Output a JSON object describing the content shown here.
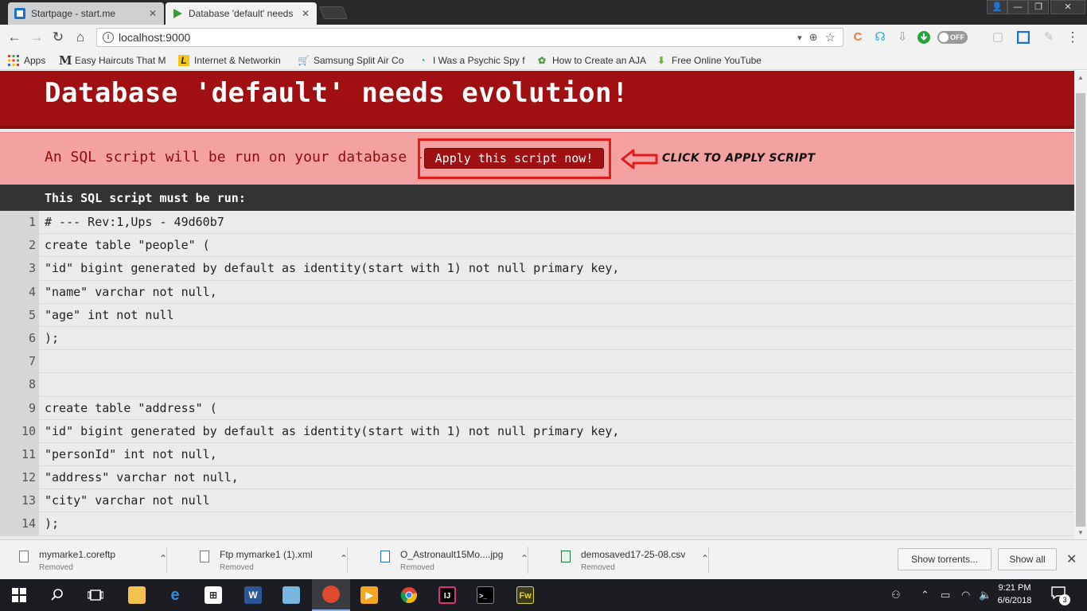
{
  "tabs": [
    {
      "title": "Startpage - start.me",
      "close": "✕"
    },
    {
      "title": "Database 'default' needs",
      "close": "✕"
    }
  ],
  "window_controls": {
    "user": "👤",
    "minimize": "—",
    "restore": "❐",
    "close": "✕"
  },
  "toolbar": {
    "back": "←",
    "forward": "→",
    "reload": "↻",
    "home": "⌂",
    "url": "localhost:9000",
    "info_icon": "i",
    "omnibox_icons": {
      "dropdown": "▾",
      "zoom": "⊕",
      "star": "☆"
    },
    "toggle_label": "OFF",
    "menu": "⋮"
  },
  "bookmarks": [
    {
      "label": "Apps",
      "icon": "apps-icon"
    },
    {
      "label": "Easy Haircuts That M",
      "icon": "m-icon"
    },
    {
      "label": "Internet & Networkin",
      "icon": "l-icon"
    },
    {
      "label": "Samsung Split Air Co",
      "icon": "cart-icon"
    },
    {
      "label": "I Was a Psychic Spy f",
      "icon": "swirl-icon"
    },
    {
      "label": "How to Create an AJA",
      "icon": "gear-icon"
    },
    {
      "label": "Free Online YouTube",
      "icon": "download-icon"
    }
  ],
  "page": {
    "heading": "Database 'default' needs evolution!",
    "message": "An SQL script will be run on your database -",
    "apply_button": "Apply this script now!",
    "callout": "CLICK TO APPLY SCRIPT",
    "script_label": "This SQL script must be run:",
    "lines": [
      {
        "n": "1",
        "text": "# --- Rev:1,Ups - 49d60b7"
      },
      {
        "n": "2",
        "text": "create table \"people\" ("
      },
      {
        "n": "3",
        "text": "\"id\" bigint generated by default as identity(start with 1) not null primary key,"
      },
      {
        "n": "4",
        "text": "\"name\" varchar not null,"
      },
      {
        "n": "5",
        "text": "\"age\" int not null"
      },
      {
        "n": "6",
        "text": ");"
      },
      {
        "n": "7",
        "text": ""
      },
      {
        "n": "8",
        "text": ""
      },
      {
        "n": "9",
        "text": "create table \"address\" ("
      },
      {
        "n": "10",
        "text": "\"id\" bigint generated by default as identity(start with 1) not null primary key,"
      },
      {
        "n": "11",
        "text": "\"personId\" int not null,"
      },
      {
        "n": "12",
        "text": "\"address\" varchar not null,"
      },
      {
        "n": "13",
        "text": "\"city\" varchar not null"
      },
      {
        "n": "14",
        "text": ");"
      }
    ]
  },
  "downloads": [
    {
      "name": "mymarke1.coreftp",
      "status": "Removed"
    },
    {
      "name": "Ftp mymarke1 (1).xml",
      "status": "Removed"
    },
    {
      "name": "O_Astronault15Mo....jpg",
      "status": "Removed"
    },
    {
      "name": "demosaved17-25-08.csv",
      "status": "Removed"
    }
  ],
  "shelf": {
    "show_torrents": "Show torrents...",
    "show_all": "Show all",
    "close": "✕"
  },
  "taskbar": {
    "time": "9:21 PM",
    "date": "6/6/2018",
    "notifications": "3",
    "apps": [
      "explorer",
      "edge",
      "store",
      "word",
      "notepad",
      "browser",
      "media",
      "chrome",
      "intellij",
      "cmd",
      "fireworks"
    ]
  },
  "colors": {
    "banner": "#a00f12",
    "pink": "#f3a1a1",
    "highlight": "#e21b1b"
  }
}
